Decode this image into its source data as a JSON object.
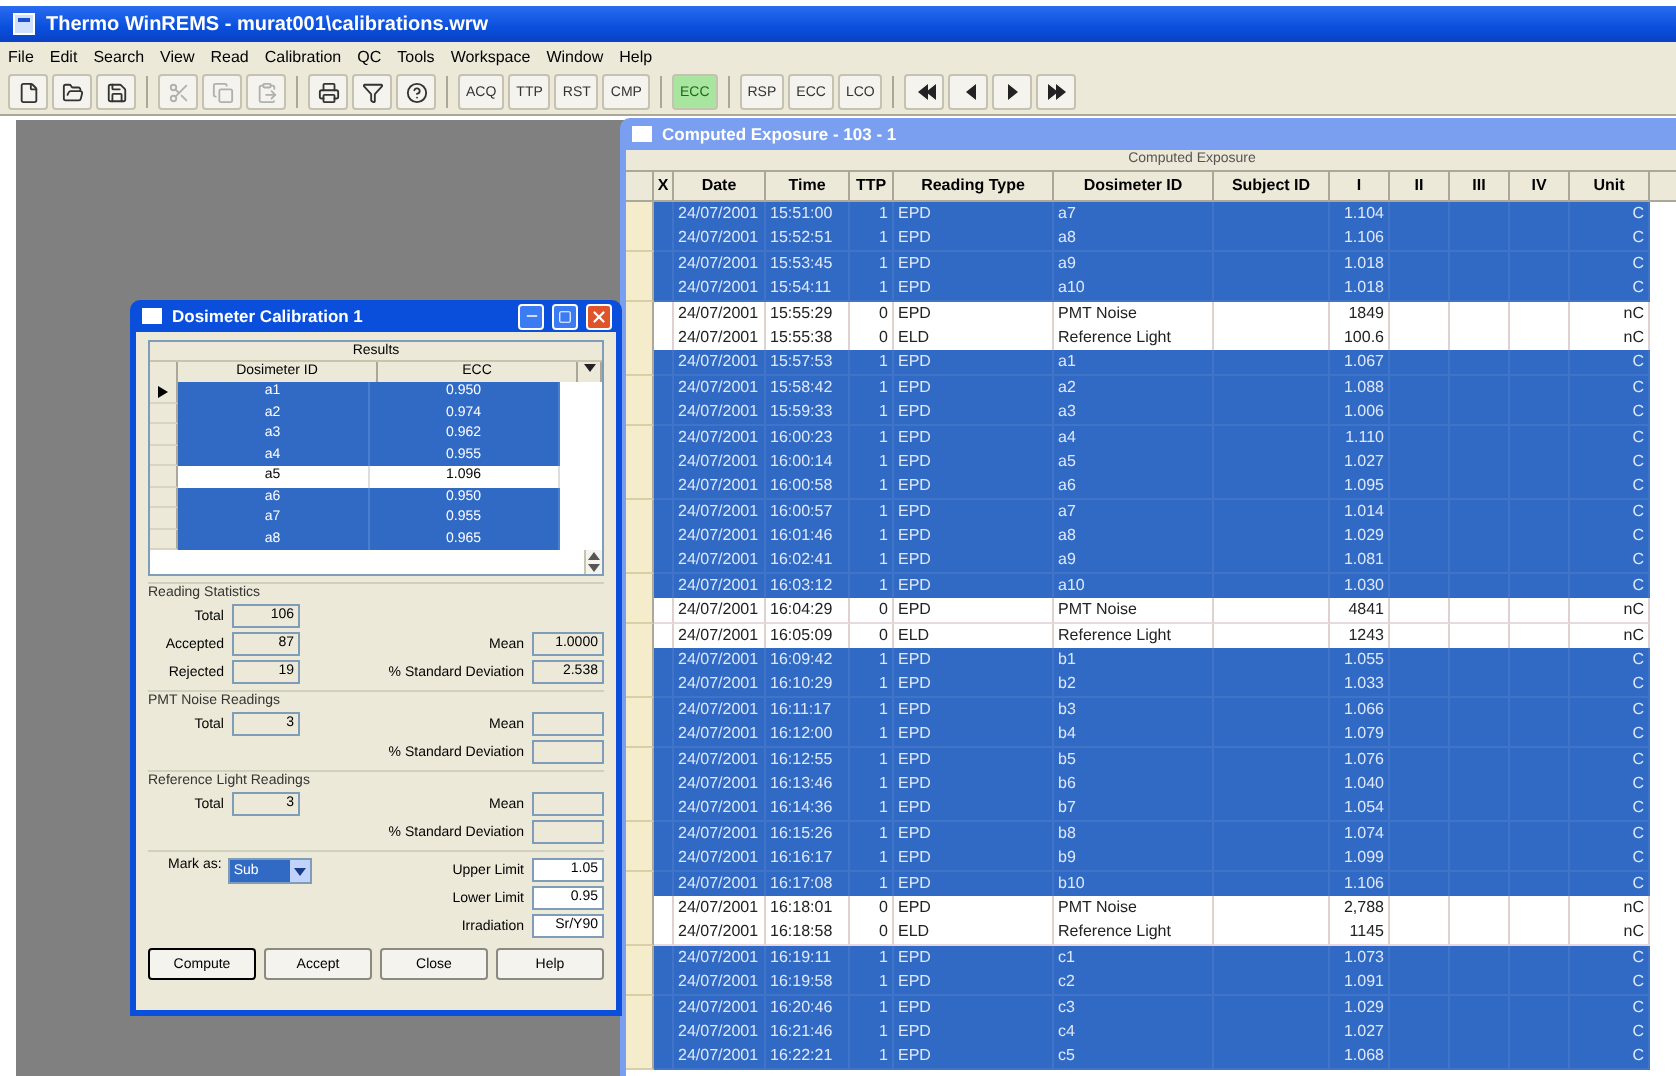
{
  "app_window": {
    "title": "Thermo WinREMS - murat001\\calibrations.wrw",
    "menu": [
      "File",
      "Edit",
      "Search",
      "View",
      "Read",
      "Calibration",
      "QC",
      "Tools",
      "Workspace",
      "Window",
      "Help"
    ],
    "toolbar_groups": [
      [
        {
          "label": "ACQ",
          "highlighted": false
        },
        {
          "label": "TTP",
          "highlighted": false
        },
        {
          "label": "RST",
          "highlighted": false
        },
        {
          "label": "CMP",
          "highlighted": false
        }
      ],
      [
        {
          "label": "ECC",
          "highlighted": true
        }
      ],
      [
        {
          "label": "RSP",
          "highlighted": false
        },
        {
          "label": "ECC",
          "highlighted": false
        },
        {
          "label": "LCO",
          "highlighted": false
        }
      ]
    ]
  },
  "calibration_dialog": {
    "title": "Dosimeter Calibration 1",
    "results": {
      "caption": "Results",
      "columns": [
        "Dosimeter ID",
        "ECC"
      ],
      "rows": [
        {
          "id": "a1",
          "ecc": "0.950",
          "selected": true,
          "current": true
        },
        {
          "id": "a2",
          "ecc": "0.974",
          "selected": true,
          "current": false
        },
        {
          "id": "a3",
          "ecc": "0.962",
          "selected": true,
          "current": false
        },
        {
          "id": "a4",
          "ecc": "0.955",
          "selected": true,
          "current": false
        },
        {
          "id": "a5",
          "ecc": "1.096",
          "selected": false,
          "current": false
        },
        {
          "id": "a6",
          "ecc": "0.950",
          "selected": true,
          "current": false
        },
        {
          "id": "a7",
          "ecc": "0.955",
          "selected": true,
          "current": false
        },
        {
          "id": "a8",
          "ecc": "0.965",
          "selected": true,
          "current": false
        }
      ]
    },
    "reading_statistics": {
      "caption": "Reading Statistics",
      "total_label": "Total",
      "total": "106",
      "accepted_label": "Accepted",
      "accepted": "87",
      "rejected_label": "Rejected",
      "rejected": "19",
      "mean_label": "Mean",
      "mean": "1.0000",
      "sd_label": "% Standard Deviation",
      "sd": "2.538"
    },
    "pmt_noise": {
      "caption": "PMT Noise Readings",
      "total_label": "Total",
      "total": "3",
      "mean_label": "Mean",
      "sd_label": "% Standard Deviation"
    },
    "reference_light": {
      "caption": "Reference Light Readings",
      "total_label": "Total",
      "total": "3",
      "mean_label": "Mean",
      "sd_label": "% Standard Deviation"
    },
    "mark_as": {
      "label": "Mark as:",
      "value": "Sub"
    },
    "limits": [
      {
        "label": "Upper Limit",
        "value": "1.05"
      },
      {
        "label": "Lower Limit",
        "value": "0.95"
      },
      {
        "label": "Irradiation",
        "value": "Sr/Y90"
      }
    ],
    "buttons": [
      {
        "label": "Compute",
        "focused": true
      },
      {
        "label": "Accept",
        "focused": false
      },
      {
        "label": "Close",
        "focused": false
      },
      {
        "label": "Help",
        "focused": false
      }
    ]
  },
  "exposure_window": {
    "title": "Computed Exposure - 103 - 1",
    "caption": "Computed Exposure",
    "columns": [
      "X",
      "Date",
      "Time",
      "TTP",
      "Reading Type",
      "Dosimeter ID",
      "Subject ID",
      "I",
      "II",
      "III",
      "IV",
      "Unit"
    ],
    "rows": [
      {
        "date": "24/07/2001",
        "time": "15:51:00",
        "ttp": "1",
        "type": "EPD",
        "dosimeter": "a7",
        "i": "1.104",
        "unit": "C",
        "selected": true
      },
      {
        "date": "24/07/2001",
        "time": "15:52:51",
        "ttp": "1",
        "type": "EPD",
        "dosimeter": "a8",
        "i": "1.106",
        "unit": "C",
        "selected": true
      },
      {
        "date": "24/07/2001",
        "time": "15:53:45",
        "ttp": "1",
        "type": "EPD",
        "dosimeter": "a9",
        "i": "1.018",
        "unit": "C",
        "selected": true
      },
      {
        "date": "24/07/2001",
        "time": "15:54:11",
        "ttp": "1",
        "type": "EPD",
        "dosimeter": "a10",
        "i": "1.018",
        "unit": "C",
        "selected": true
      },
      {
        "date": "24/07/2001",
        "time": "15:55:29",
        "ttp": "0",
        "type": "EPD",
        "dosimeter": "PMT Noise",
        "i": "1849",
        "unit": "nC",
        "selected": false
      },
      {
        "date": "24/07/2001",
        "time": "15:55:38",
        "ttp": "0",
        "type": "ELD",
        "dosimeter": "Reference Light",
        "i": "100.6",
        "unit": "nC",
        "selected": false
      },
      {
        "date": "24/07/2001",
        "time": "15:57:53",
        "ttp": "1",
        "type": "EPD",
        "dosimeter": "a1",
        "i": "1.067",
        "unit": "C",
        "selected": true
      },
      {
        "date": "24/07/2001",
        "time": "15:58:42",
        "ttp": "1",
        "type": "EPD",
        "dosimeter": "a2",
        "i": "1.088",
        "unit": "C",
        "selected": true
      },
      {
        "date": "24/07/2001",
        "time": "15:59:33",
        "ttp": "1",
        "type": "EPD",
        "dosimeter": "a3",
        "i": "1.006",
        "unit": "C",
        "selected": true
      },
      {
        "date": "24/07/2001",
        "time": "16:00:23",
        "ttp": "1",
        "type": "EPD",
        "dosimeter": "a4",
        "i": "1.110",
        "unit": "C",
        "selected": true
      },
      {
        "date": "24/07/2001",
        "time": "16:00:14",
        "ttp": "1",
        "type": "EPD",
        "dosimeter": "a5",
        "i": "1.027",
        "unit": "C",
        "selected": true
      },
      {
        "date": "24/07/2001",
        "time": "16:00:58",
        "ttp": "1",
        "type": "EPD",
        "dosimeter": "a6",
        "i": "1.095",
        "unit": "C",
        "selected": true
      },
      {
        "date": "24/07/2001",
        "time": "16:00:57",
        "ttp": "1",
        "type": "EPD",
        "dosimeter": "a7",
        "i": "1.014",
        "unit": "C",
        "selected": true
      },
      {
        "date": "24/07/2001",
        "time": "16:01:46",
        "ttp": "1",
        "type": "EPD",
        "dosimeter": "a8",
        "i": "1.029",
        "unit": "C",
        "selected": true
      },
      {
        "date": "24/07/2001",
        "time": "16:02:41",
        "ttp": "1",
        "type": "EPD",
        "dosimeter": "a9",
        "i": "1.081",
        "unit": "C",
        "selected": true
      },
      {
        "date": "24/07/2001",
        "time": "16:03:12",
        "ttp": "1",
        "type": "EPD",
        "dosimeter": "a10",
        "i": "1.030",
        "unit": "C",
        "selected": true
      },
      {
        "date": "24/07/2001",
        "time": "16:04:29",
        "ttp": "0",
        "type": "EPD",
        "dosimeter": "PMT Noise",
        "i": "4841",
        "unit": "nC",
        "selected": false
      },
      {
        "date": "24/07/2001",
        "time": "16:05:09",
        "ttp": "0",
        "type": "ELD",
        "dosimeter": "Reference Light",
        "i": "1243",
        "unit": "nC",
        "selected": false
      },
      {
        "date": "24/07/2001",
        "time": "16:09:42",
        "ttp": "1",
        "type": "EPD",
        "dosimeter": "b1",
        "i": "1.055",
        "unit": "C",
        "selected": true
      },
      {
        "date": "24/07/2001",
        "time": "16:10:29",
        "ttp": "1",
        "type": "EPD",
        "dosimeter": "b2",
        "i": "1.033",
        "unit": "C",
        "selected": true
      },
      {
        "date": "24/07/2001",
        "time": "16:11:17",
        "ttp": "1",
        "type": "EPD",
        "dosimeter": "b3",
        "i": "1.066",
        "unit": "C",
        "selected": true
      },
      {
        "date": "24/07/2001",
        "time": "16:12:00",
        "ttp": "1",
        "type": "EPD",
        "dosimeter": "b4",
        "i": "1.079",
        "unit": "C",
        "selected": true
      },
      {
        "date": "24/07/2001",
        "time": "16:12:55",
        "ttp": "1",
        "type": "EPD",
        "dosimeter": "b5",
        "i": "1.076",
        "unit": "C",
        "selected": true
      },
      {
        "date": "24/07/2001",
        "time": "16:13:46",
        "ttp": "1",
        "type": "EPD",
        "dosimeter": "b6",
        "i": "1.040",
        "unit": "C",
        "selected": true
      },
      {
        "date": "24/07/2001",
        "time": "16:14:36",
        "ttp": "1",
        "type": "EPD",
        "dosimeter": "b7",
        "i": "1.054",
        "unit": "C",
        "selected": true
      },
      {
        "date": "24/07/2001",
        "time": "16:15:26",
        "ttp": "1",
        "type": "EPD",
        "dosimeter": "b8",
        "i": "1.074",
        "unit": "C",
        "selected": true
      },
      {
        "date": "24/07/2001",
        "time": "16:16:17",
        "ttp": "1",
        "type": "EPD",
        "dosimeter": "b9",
        "i": "1.099",
        "unit": "C",
        "selected": true
      },
      {
        "date": "24/07/2001",
        "time": "16:17:08",
        "ttp": "1",
        "type": "EPD",
        "dosimeter": "b10",
        "i": "1.106",
        "unit": "C",
        "selected": true
      },
      {
        "date": "24/07/2001",
        "time": "16:18:01",
        "ttp": "0",
        "type": "EPD",
        "dosimeter": "PMT Noise",
        "i": "2,788",
        "unit": "nC",
        "selected": false
      },
      {
        "date": "24/07/2001",
        "time": "16:18:58",
        "ttp": "0",
        "type": "ELD",
        "dosimeter": "Reference Light",
        "i": "1145",
        "unit": "nC",
        "selected": false
      },
      {
        "date": "24/07/2001",
        "time": "16:19:11",
        "ttp": "1",
        "type": "EPD",
        "dosimeter": "c1",
        "i": "1.073",
        "unit": "C",
        "selected": true
      },
      {
        "date": "24/07/2001",
        "time": "16:19:58",
        "ttp": "1",
        "type": "EPD",
        "dosimeter": "c2",
        "i": "1.091",
        "unit": "C",
        "selected": true
      },
      {
        "date": "24/07/2001",
        "time": "16:20:46",
        "ttp": "1",
        "type": "EPD",
        "dosimeter": "c3",
        "i": "1.029",
        "unit": "C",
        "selected": true
      },
      {
        "date": "24/07/2001",
        "time": "16:21:46",
        "ttp": "1",
        "type": "EPD",
        "dosimeter": "c4",
        "i": "1.027",
        "unit": "C",
        "selected": true
      },
      {
        "date": "24/07/2001",
        "time": "16:22:21",
        "ttp": "1",
        "type": "EPD",
        "dosimeter": "c5",
        "i": "1.068",
        "unit": "C",
        "selected": true
      }
    ]
  }
}
